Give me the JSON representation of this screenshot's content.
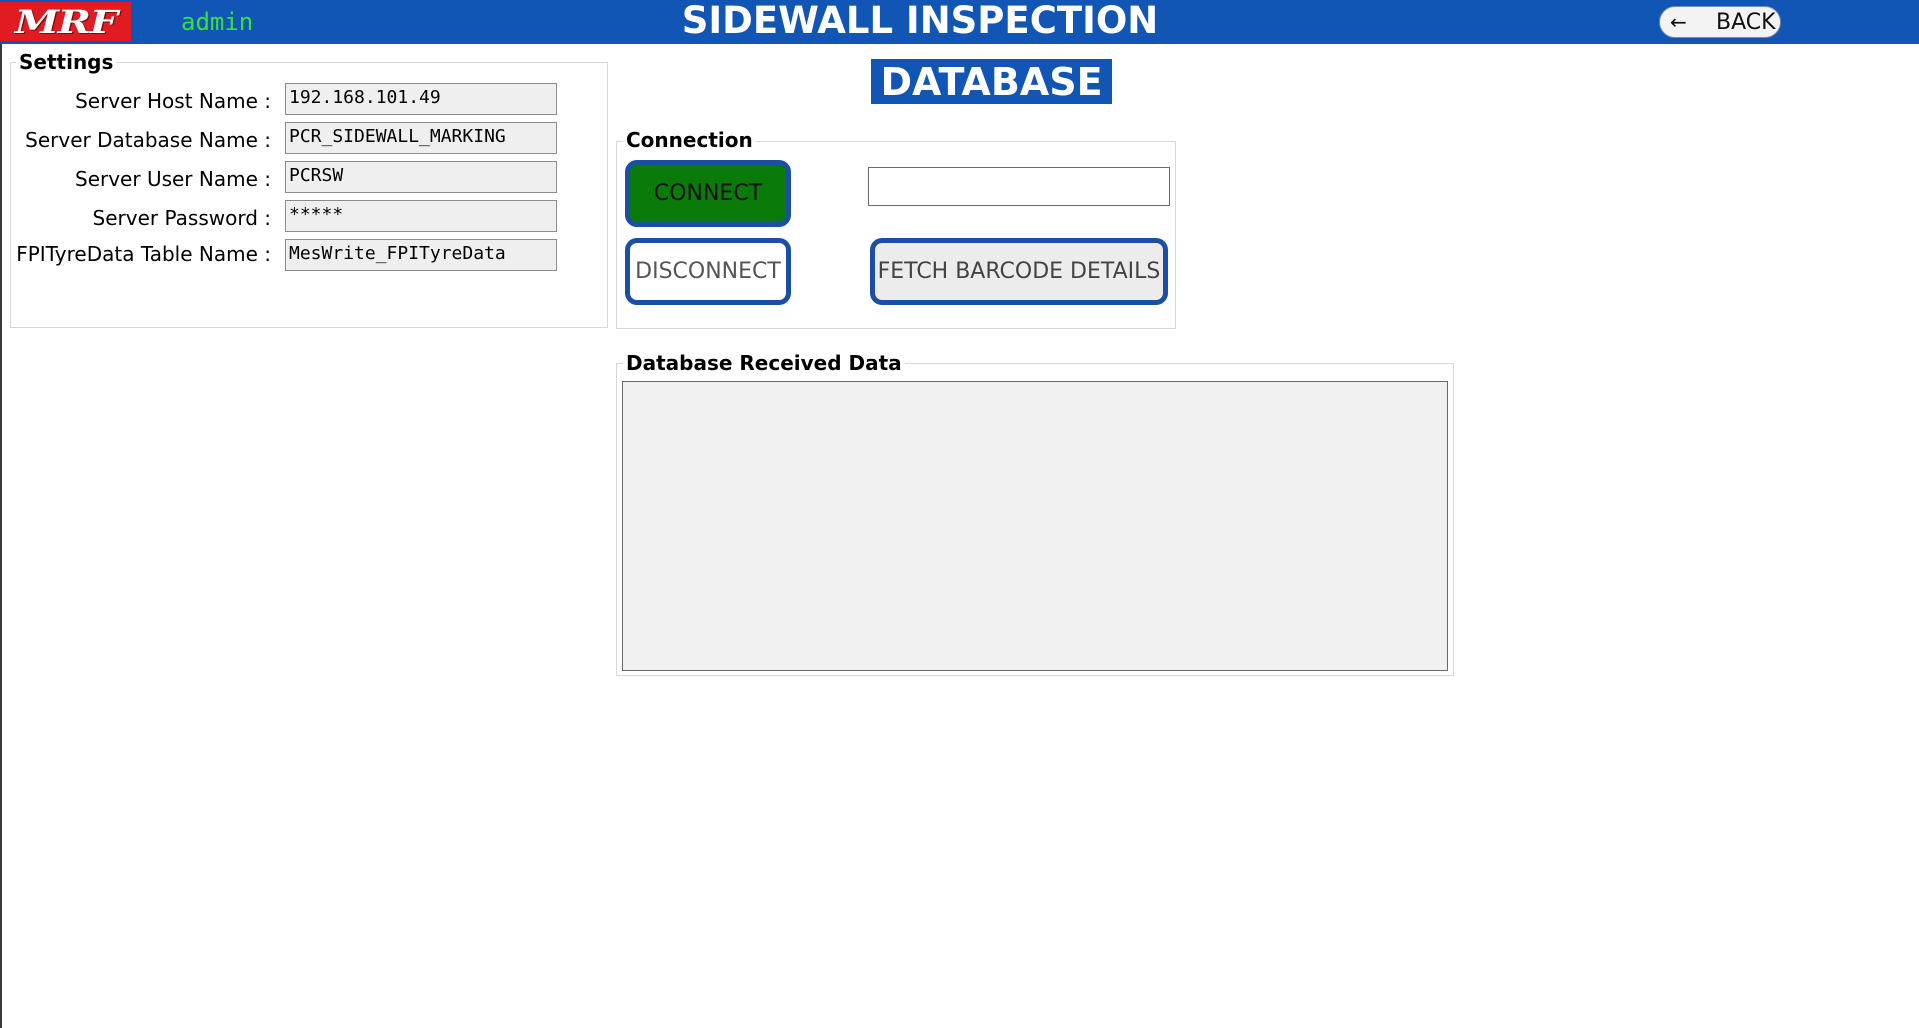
{
  "header": {
    "logo_text": "MRF",
    "user": "admin",
    "title": "SIDEWALL INSPECTION",
    "back_label": "BACK",
    "back_icon": "arrow-left-icon",
    "colors": {
      "bar": "#1155b5",
      "logo_bg": "#e11b22",
      "user_text": "#36e23a"
    }
  },
  "page_label": "DATABASE",
  "settings": {
    "title": "Settings",
    "fields": [
      {
        "label": "Server Host Name :",
        "value": "192.168.101.49"
      },
      {
        "label": "Server Database Name :",
        "value": "PCR_SIDEWALL_MARKING"
      },
      {
        "label": "Server User Name :",
        "value": "PCRSW"
      },
      {
        "label": "Server Password :",
        "value": "*****"
      },
      {
        "label": "FPITyreData Table Name :",
        "value": "MesWrite_FPITyreData"
      }
    ]
  },
  "connection": {
    "title": "Connection",
    "connect_label": "CONNECT",
    "disconnect_label": "DISCONNECT",
    "fetch_label": "FETCH BARCODE DETAILS",
    "status_text": "",
    "colors": {
      "connect_bg": "#0a7a0a",
      "button_border": "#1a4fa3"
    }
  },
  "received": {
    "title": "Database Received Data",
    "content": ""
  }
}
